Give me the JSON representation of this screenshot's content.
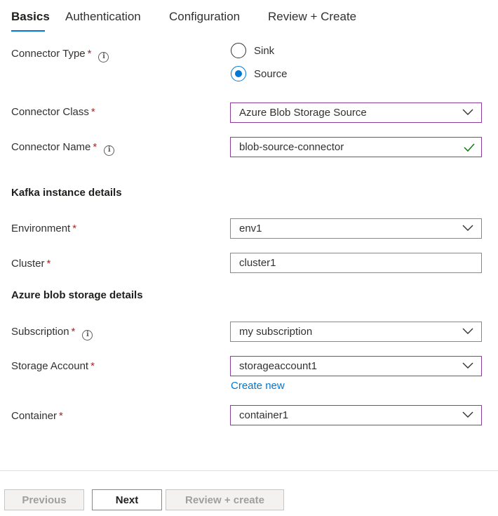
{
  "tabs": [
    "Basics",
    "Authentication",
    "Configuration",
    "Review + Create"
  ],
  "fields": {
    "connector_type": {
      "label": "Connector Type",
      "required": "*",
      "options": [
        "Sink",
        "Source"
      ],
      "selected": "Source"
    },
    "connector_class": {
      "label": "Connector Class",
      "required": "*",
      "value": "Azure Blob Storage Source"
    },
    "connector_name": {
      "label": "Connector Name",
      "required": "*",
      "value": "blob-source-connector"
    },
    "environment": {
      "label": "Environment",
      "required": "*",
      "value": "env1"
    },
    "cluster": {
      "label": "Cluster",
      "required": "*",
      "value": "cluster1"
    },
    "subscription": {
      "label": "Subscription",
      "required": "*",
      "value": "my subscription"
    },
    "storage_account": {
      "label": "Storage Account",
      "required": "*",
      "value": "storageaccount1",
      "create_new": "Create new"
    },
    "container": {
      "label": "Container",
      "required": "*",
      "value": "container1"
    }
  },
  "sections": {
    "kafka": "Kafka instance details",
    "azure": "Azure blob storage details"
  },
  "buttons": {
    "previous": "Previous",
    "next": "Next",
    "review": "Review + create"
  },
  "colors": {
    "accent": "#0078d4",
    "required": "#a4262c",
    "active_border": "#8a3e9a",
    "valid_check": "#107c10"
  },
  "icons": [
    "info-icon",
    "chevron-down-icon",
    "checkmark-icon"
  ]
}
